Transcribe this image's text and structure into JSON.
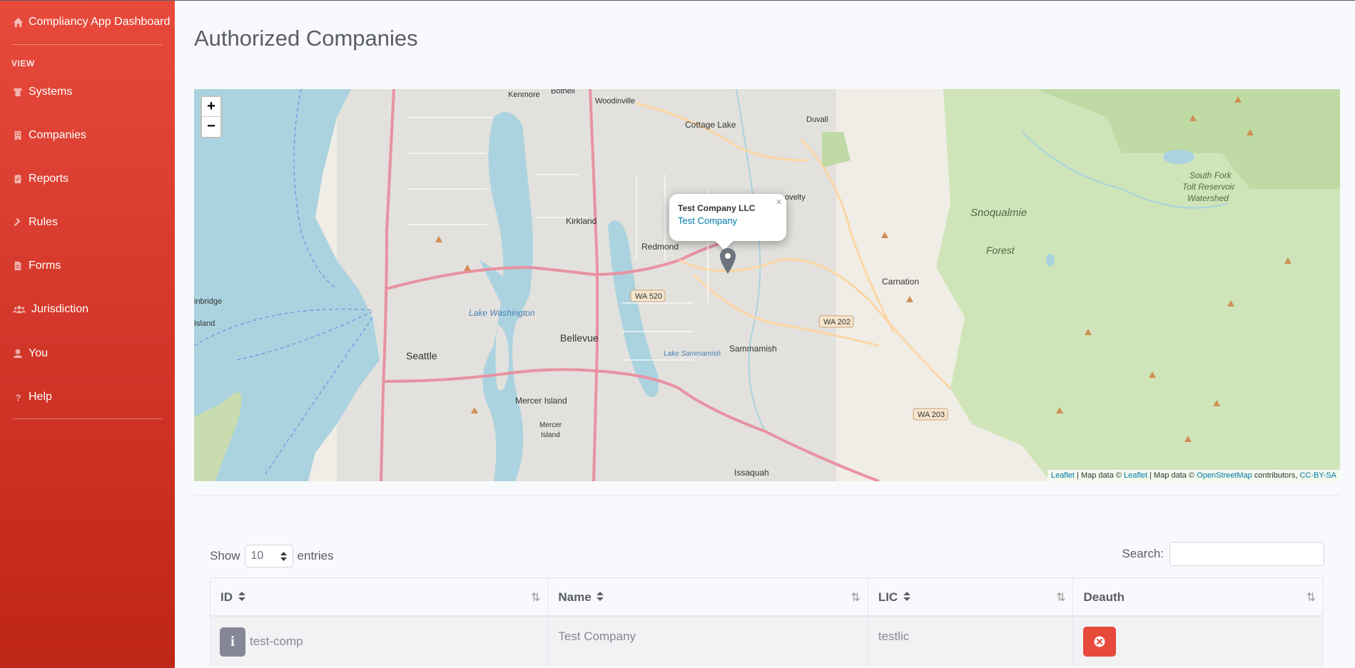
{
  "sidebar": {
    "brand": "Compliancy App Dashboard",
    "heading": "VIEW",
    "items": [
      {
        "label": "Systems",
        "icon": "tshirt-icon"
      },
      {
        "label": "Companies",
        "icon": "building-icon"
      },
      {
        "label": "Reports",
        "icon": "clipboard-check-icon"
      },
      {
        "label": "Rules",
        "icon": "gavel-icon"
      },
      {
        "label": "Forms",
        "icon": "file-icon"
      },
      {
        "label": "Jurisdiction",
        "icon": "users-icon"
      },
      {
        "label": "You",
        "icon": "user-icon"
      },
      {
        "label": "Help",
        "icon": "question-icon"
      }
    ]
  },
  "page": {
    "title": "Authorized Companies"
  },
  "map": {
    "zoom_in": "+",
    "zoom_out": "−",
    "popup": {
      "title": "Test Company LLC",
      "link": "Test Company",
      "close": "×"
    },
    "labels": {
      "seattle": "Seattle",
      "bellevue": "Bellevue",
      "kirkland": "Kirkland",
      "redmond": "Redmond",
      "sammamish": "Sammamish",
      "issaquah": "Issaquah",
      "mercer_island": "Mercer Island",
      "woodinville": "Woodinville",
      "bothell": "Bothell",
      "kenmore": "Kenmore",
      "duvall": "Duvall",
      "cottage_lake": "Cottage Lake",
      "carnation": "Carnation",
      "snoqualmie_1": "Snoqualmie",
      "snoqualmie_2": "Forest",
      "tolt_1": "South Fork",
      "tolt_2": "Tolt Reservoir",
      "tolt_3": "Watershed",
      "lake_washington": "Lake Washington",
      "lake_sammamish": "Lake Sammamish",
      "wa520": "WA 520",
      "wa202": "WA 202",
      "wa203": "WA 203",
      "bainbridge_1": "inbridge",
      "bainbridge_2": "Island",
      "mercer_isl_1": "Mercer",
      "mercer_isl_2": "Island",
      "novelty": "ovelty"
    },
    "attribution": {
      "leaflet1": "Leaflet",
      "sep1": " | Map data © ",
      "leaflet2": "Leaflet",
      "sep2": " | Map data © ",
      "osm": "OpenStreetMap",
      "contrib": " contributors, ",
      "license": "CC-BY-SA"
    }
  },
  "table_controls": {
    "show_label": "Show",
    "entries_value": "10",
    "entries_label": "entries",
    "search_label": "Search:",
    "search_value": ""
  },
  "table": {
    "columns": [
      "ID",
      "Name",
      "LIC",
      "Deauth"
    ],
    "rows": [
      {
        "id": "test-comp",
        "name": "Test Company",
        "lic": "testlic"
      }
    ]
  },
  "colors": {
    "sidebar_top": "#e74a3b",
    "sidebar_bottom": "#be2617",
    "danger": "#e74a3b",
    "link": "#0078a8"
  }
}
